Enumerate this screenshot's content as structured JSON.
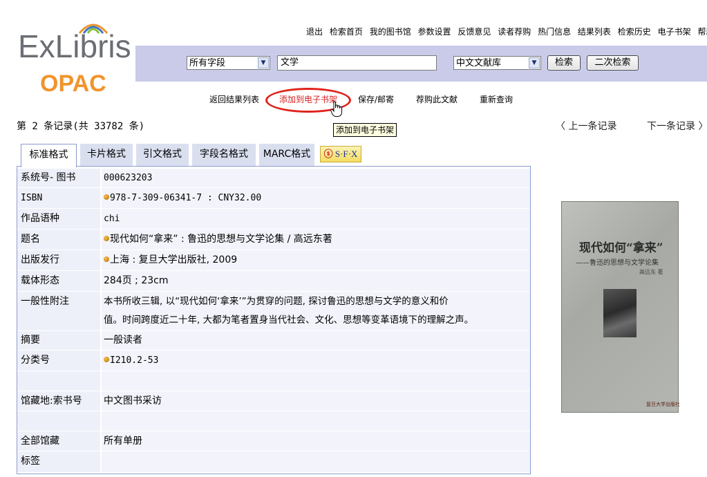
{
  "logo": {
    "main": "ExLibris",
    "sub": "OPAC"
  },
  "top_links": [
    "退出",
    "检索首页",
    "我的图书馆",
    "参数设置",
    "反馈意见",
    "读者荐购",
    "热门信息",
    "结果列表",
    "检索历史",
    "电子书架",
    "帮助"
  ],
  "search": {
    "field_select": "所有字段",
    "query": "文学",
    "db_select": "中文文献库",
    "search_button": "检索",
    "secondary_button": "二次检索"
  },
  "actions": {
    "back": "返回结果列表",
    "add_shelf": "添加到电子书架",
    "save_mail": "保存/邮寄",
    "recommend": "荐购此文献",
    "requery": "重新查询"
  },
  "tooltip": "添加到电子书架",
  "record_info": "第 2 条记录(共 33782 条)",
  "nav": {
    "prev": "〈 上一条记录",
    "next": "下一条记录 〉"
  },
  "tabs": [
    "标准格式",
    "卡片格式",
    "引文格式",
    "字段名格式",
    "MARC格式"
  ],
  "sfx_label": "S·F·X",
  "record": [
    {
      "label": "系统号- 图书",
      "value": "000623203"
    },
    {
      "label": "ISBN",
      "value": "978-7-309-06341-7 : CNY32.00"
    },
    {
      "label": "作品语种",
      "value": "chi"
    },
    {
      "label": "题名",
      "value": "现代如何“拿来” : 鲁迅的思想与文学论集 / 高远东著"
    },
    {
      "label": "出版发行",
      "value": "上海 : 复旦大学出版社, 2009"
    },
    {
      "label": "载体形态",
      "value": "284页 ; 23cm"
    },
    {
      "label": "一般性附注",
      "value_line1": "本书所收三辑, 以“现代如何‘拿来’”为贯穿的问题, 探讨鲁迅的思想与文学的意义和价",
      "value_line2": "值。时间跨度近二十年, 大都为笔者置身当代社会、文化、思想等变革语境下的理解之声。"
    },
    {
      "label": "摘要",
      "value": "一般读者"
    },
    {
      "label": "分类号",
      "value": "I210.2-53"
    },
    {
      "label": "",
      "value": ""
    },
    {
      "label": "馆藏地:索书号",
      "value": "中文图书采访"
    },
    {
      "label": "",
      "value": ""
    },
    {
      "label": "全部馆藏",
      "value": "所有单册"
    },
    {
      "label": "标签",
      "value": ""
    }
  ],
  "cover": {
    "title": "现代如何“拿来”",
    "subtitle": "——鲁迅的思想与文学论集",
    "author": "高远东 著",
    "publisher": "复旦大学出版社"
  }
}
